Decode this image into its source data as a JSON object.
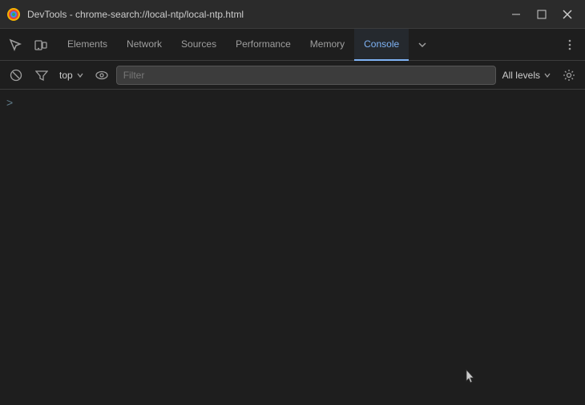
{
  "titlebar": {
    "icon_alt": "chrome-devtools",
    "title": "DevTools - chrome-search://local-ntp/local-ntp.html",
    "minimize_label": "minimize",
    "maximize_label": "maximize",
    "close_label": "close"
  },
  "tabs": {
    "items": [
      {
        "id": "elements",
        "label": "Elements",
        "active": false
      },
      {
        "id": "network",
        "label": "Network",
        "active": false
      },
      {
        "id": "sources",
        "label": "Sources",
        "active": false
      },
      {
        "id": "performance",
        "label": "Performance",
        "active": false
      },
      {
        "id": "memory",
        "label": "Memory",
        "active": false
      },
      {
        "id": "console",
        "label": "Console",
        "active": true
      }
    ],
    "more_label": "more",
    "settings_label": "settings"
  },
  "toolbar": {
    "context_value": "top",
    "filter_placeholder": "Filter",
    "log_level": "All levels"
  },
  "console": {
    "prompt_char": ">"
  }
}
